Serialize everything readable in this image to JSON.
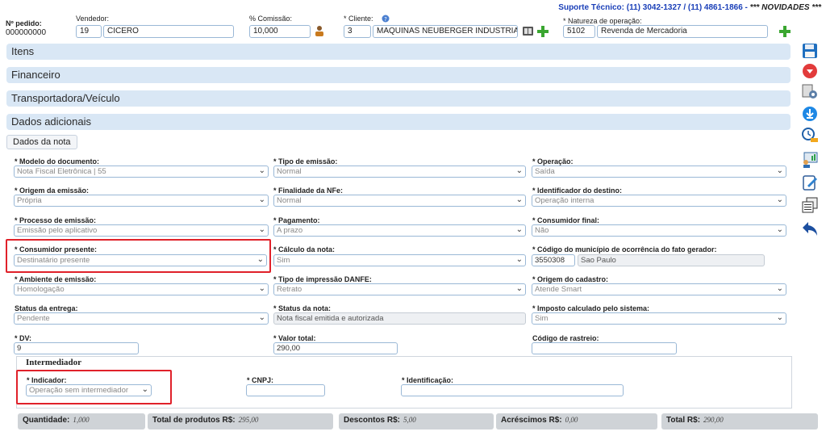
{
  "header": {
    "support": "Suporte Técnico: (11) 3042-1327 / (11) 4861-1866 -",
    "novidades": "*** NOVIDADES ***",
    "pedido_label": "Nº pedido:",
    "pedido_value": "000000000",
    "vendedor_label": "Vendedor:",
    "vendedor_code": "19",
    "vendedor_name": "CICERO",
    "comissao_label": "% Comissão:",
    "comissao_value": "10,000",
    "cliente_label": "* Cliente:",
    "cliente_code": "3",
    "cliente_name": "MAQUINAS NEUBERGER INDUSTRIA E C",
    "natureza_label": "* Natureza de operação:",
    "natureza_code": "5102",
    "natureza_name": "Revenda de Mercadoria"
  },
  "sections": [
    "Itens",
    "Financeiro",
    "Transportadora/Veículo",
    "Dados adicionais"
  ],
  "tab": "Dados da nota",
  "fields": {
    "modelo": {
      "label": "* Modelo do documento:",
      "value": "Nota Fiscal Eletrônica | 55"
    },
    "tipo_emissao": {
      "label": "* Tipo de emissão:",
      "value": "Normal"
    },
    "operacao": {
      "label": "* Operação:",
      "value": "Saída"
    },
    "origem_emissao": {
      "label": "* Origem da emissão:",
      "value": "Própria"
    },
    "finalidade": {
      "label": "* Finalidade da NFe:",
      "value": "Normal"
    },
    "ident_destino": {
      "label": "* Identificador do destino:",
      "value": "Operação interna"
    },
    "processo": {
      "label": "* Processo de emissão:",
      "value": "Emissão pelo aplicativo"
    },
    "pagamento": {
      "label": "* Pagamento:",
      "value": "A prazo"
    },
    "consumidor_final": {
      "label": "* Consumidor final:",
      "value": "Não"
    },
    "consumidor_presente": {
      "label": "* Consumidor presente:",
      "value": "Destinatário presente"
    },
    "calculo": {
      "label": "* Cálculo da nota:",
      "value": "Sim"
    },
    "municipio": {
      "label": "* Código do município de ocorrência do fato gerador:",
      "code": "3550308",
      "name": "Sao Paulo"
    },
    "ambiente": {
      "label": "* Ambiente de emissão:",
      "value": "Homologação"
    },
    "tipo_impressao": {
      "label": "* Tipo de impressão DANFE:",
      "value": "Retrato"
    },
    "origem_cadastro": {
      "label": "* Origem do cadastro:",
      "value": "Atende Smart"
    },
    "status_entrega": {
      "label": "Status da entrega:",
      "value": "Pendente"
    },
    "status_nota": {
      "label": "* Status da nota:",
      "value": "Nota fiscal emitida e autorizada"
    },
    "imposto": {
      "label": "* Imposto calculado pelo sistema:",
      "value": "Sim"
    },
    "dv": {
      "label": "* DV:",
      "value": "9"
    },
    "valor_total": {
      "label": "* Valor total:",
      "value": "290,00"
    },
    "rastreio": {
      "label": "Código de rastreio:",
      "value": ""
    }
  },
  "intermediador": {
    "title": "Intermediador",
    "indicador_label": "* Indicador:",
    "indicador_value": "Operação sem intermediador",
    "cnpj_label": "* CNPJ:",
    "ident_label": "* Identificação:"
  },
  "totals": {
    "quantidade_label": "Quantidade:",
    "quantidade": "1,000",
    "produtos_label": "Total de produtos R$:",
    "produtos": "295,00",
    "descontos_label": "Descontos R$:",
    "descontos": "5,00",
    "acrescimos_label": "Acréscimos R$:",
    "acrescimos": "0,00",
    "total_label": "Total R$:",
    "total": "290,00"
  },
  "icons": [
    "save-icon",
    "pdf-icon",
    "danfe-gear-icon",
    "download-icon",
    "history-icon",
    "report-icon",
    "edit-icon",
    "copy-icon",
    "back-arrow-icon"
  ]
}
